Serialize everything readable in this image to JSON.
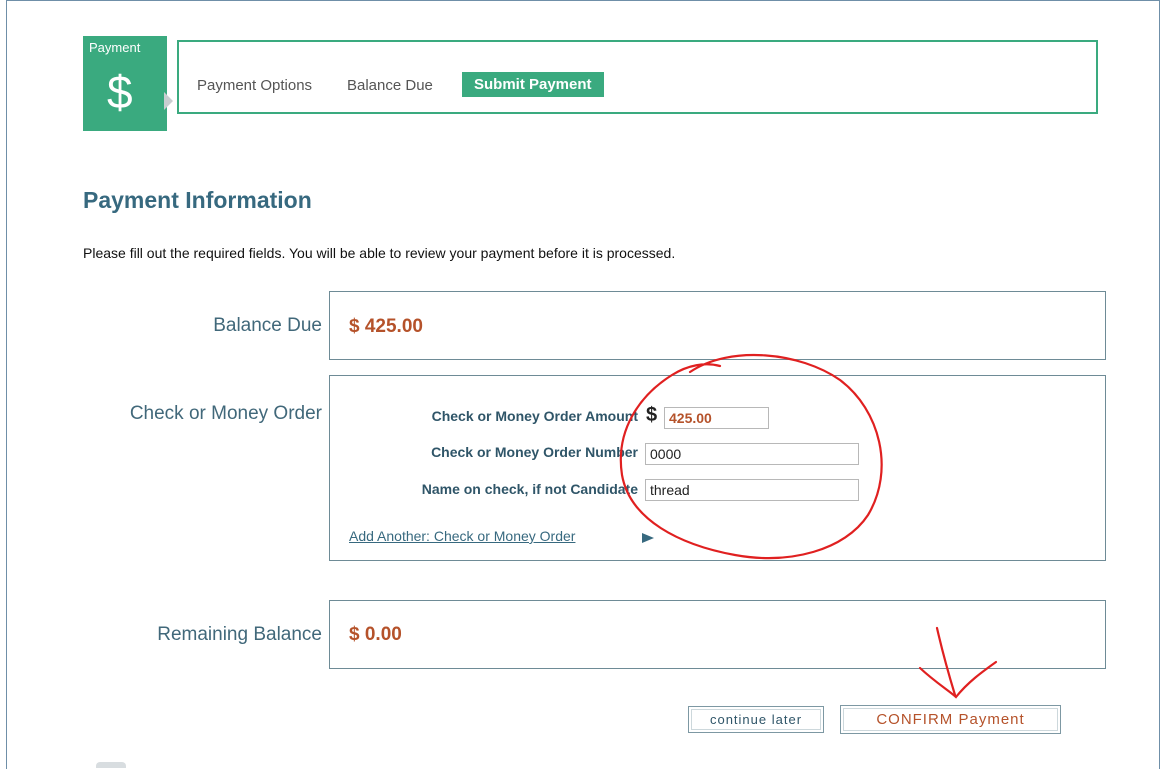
{
  "badge": {
    "label": "Payment",
    "symbol": "$"
  },
  "steps": [
    "Payment Options",
    "Balance Due",
    "Submit Payment"
  ],
  "heading": "Payment Information",
  "instructions": "Please fill out the required fields. You will be able to review your payment before it is processed.",
  "balance_due": {
    "label": "Balance Due",
    "amount": "$ 425.00"
  },
  "check": {
    "label": "Check or Money Order",
    "amount_label": "Check or Money Order Amount",
    "currency": "$",
    "amount_value": "425.00",
    "number_label": "Check or Money Order Number",
    "number_value": "0000",
    "name_label": "Name on check, if not Candidate",
    "name_value": "thread",
    "add_link": "Add Another: Check or Money Order"
  },
  "remaining": {
    "label": "Remaining Balance",
    "amount": "$ 0.00"
  },
  "buttons": {
    "continue": "continue later",
    "confirm": "CONFIRM Payment"
  },
  "colors": {
    "accent": "#3aaa7f",
    "heading": "#37697f",
    "amount": "#b5522a",
    "annotation": "#e02020"
  }
}
